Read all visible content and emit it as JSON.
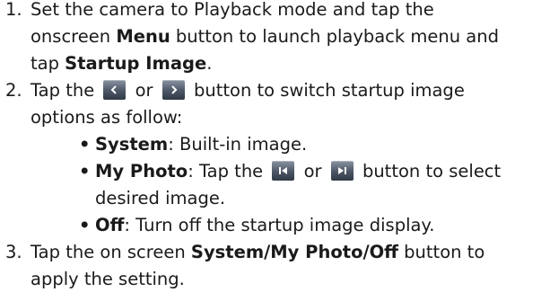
{
  "steps": [
    {
      "number": "1.",
      "lines": [
        {
          "t1": "Set the camera to Playback mode and tap the"
        },
        {
          "t1": "onscreen ",
          "b1": "Menu",
          "t2": " button to launch playback menu and"
        },
        {
          "t1": "tap ",
          "b1": "Startup Image",
          "t2": "."
        }
      ]
    },
    {
      "number": "2.",
      "line1_start": "Tap the ",
      "line1_or": " or ",
      "line1_end": " button to switch startup image",
      "line2": "options as follow:",
      "options": [
        {
          "label": "System",
          "desc": ": Built-in image."
        },
        {
          "label": "My Photo",
          "desc_start": ": Tap the ",
          "desc_or": " or ",
          "desc_end": " button to select",
          "desc_line2": "desired image."
        },
        {
          "label": "Off",
          "desc": ": Turn off the startup image display."
        }
      ]
    },
    {
      "number": "3.",
      "line1_start": "Tap the on screen ",
      "line1_bold": "System/My Photo/Off",
      "line1_end": " button to",
      "line2": "apply the setting."
    }
  ],
  "bullet_char": "•",
  "icons": {
    "left": "left-arrow-icon",
    "right": "right-arrow-icon",
    "prev": "previous-image-icon",
    "next": "next-image-icon"
  }
}
